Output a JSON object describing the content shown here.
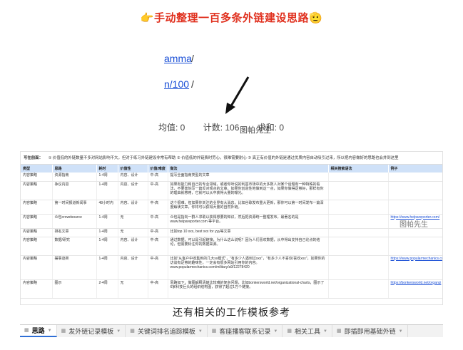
{
  "headline": {
    "left_emoji": "👉",
    "text": "手动整理一百多条外链建设思路",
    "right_emoji": "🫡"
  },
  "crop1": {
    "link1": "amma",
    "link2": "n/100",
    "slash": "/",
    "status": [
      "均值: 0",
      "计数: 106",
      "求和: 0"
    ],
    "watermark": "图帕先生"
  },
  "sheet": {
    "notice": [
      "写在前面：",
      "① 价值低的外链数量不多对网站影响不大，但对于练习外链建设非常有帮助",
      "② 价值低的外链费时劳心，很难需要耐心",
      "③ 真正有价值的外链是通过优质内容自动吸引过来，所以把内容做好的思路也会并到这里"
    ],
    "headers": [
      "类型",
      "思路",
      "耗时",
      "价值性",
      "价值/难度",
      "做法",
      "相关搜索语法",
      "例子"
    ],
    "rows": [
      [
        "内容策略",
        "资源指南",
        "1-4周",
        "内容、设计",
        "中-高",
        "提写全面指南类型的文章",
        "",
        ""
      ],
      [
        "内容策略",
        "争议内容",
        "1-4周",
        "内容、设计",
        "中-高",
        "如果有能力和自己的专业领域，或者你听说的利基市场中的大多数人对某个话题有一种特殊的看法，不要害怕写一篇反对观点的文章，如果你创造性地做到这一点，如果你做得足够好，那样有你的理由就够用，它就可以从中获得大量的曝光。",
        "",
        ""
      ],
      [
        "内容策略",
        "第一时间报道新闻事",
        "48小时内",
        "内容、设计",
        "中-高",
        "这个很难，但如果你关注的业界有大消息，比如谷歌发布重大更新，那你可以第一时间发布一篇深度解读文章，你将可以获得大量的自然外链。",
        "",
        ""
      ],
      [
        "内容策略",
        "众包crowdsource",
        "1-4周",
        "无",
        "中-高",
        "众包是指向一群人求助以获得想要的知识，然后把资源统一整理发布，最著名的是 www.helpareporter.com 等平台。",
        "",
        "https://www.helpareporter.com/"
      ],
      [
        "内容策略",
        "排名文章",
        "1-4周",
        "无",
        "中-高",
        "比如top 10 xxx, best xxx for yyy等文章",
        "",
        ""
      ],
      [
        "内容策略",
        "数据/研究",
        "1-4周",
        "内容、设计",
        "中-高",
        "通过数据，可以是引起链接，为什么这么说呢？因为人们喜欢数据，从中得出支持自己论点的结论，但需要标注你的数据来源。",
        "",
        ""
      ],
      [
        "内容策略",
        "摆事迹类",
        "1-4周",
        "内容、设计",
        "中-高",
        "比如\"从客户中收集到的几大xx模式\"，\"有多少人遇到过xxx\"，\"有多少人不喜欢/喜欢xxx\"，如果你的访谈有足够的趣味性，一定会有很多网站引用你的内容。www.popularmechanics.com/military/a9/12278420",
        "",
        "https://www.popularmechanics.com"
      ],
      [
        "内容策略",
        "图示",
        "2-4周",
        "无",
        "中-高",
        "思路如下，做图解释清楚比较难的复杂问题，比如bonkersworld.net/organizational-charts，图示了6家科技巨头的组织结构图，获得了超过1万个链接。",
        "",
        "https://bonkersworld.net/organiz"
      ]
    ]
  },
  "caption": "还有相关的工作模板参考",
  "tabs": [
    "思路",
    "发外链记录模板",
    "关键词排名追踪模板",
    "客座播客联系记录",
    "相关工具",
    "即插即用基础外链"
  ],
  "watermark_right": "图帕先生"
}
